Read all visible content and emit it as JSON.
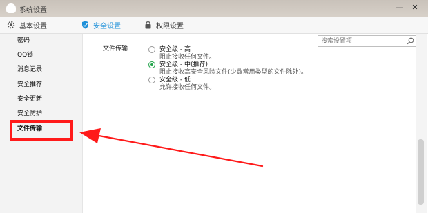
{
  "window": {
    "title": "系统设置"
  },
  "tabs": [
    {
      "label": "基本设置",
      "icon": "gear-icon"
    },
    {
      "label": "安全设置",
      "icon": "shield-icon",
      "active": true
    },
    {
      "label": "权限设置",
      "icon": "lock-icon"
    }
  ],
  "search": {
    "placeholder": "搜索设置项"
  },
  "sidebar": {
    "items": [
      {
        "label": "密码"
      },
      {
        "label": "QQ锁"
      },
      {
        "label": "消息记录"
      },
      {
        "label": "安全推荐"
      },
      {
        "label": "安全更新"
      },
      {
        "label": "安全防护"
      },
      {
        "label": "文件传输",
        "selected": true
      }
    ]
  },
  "main": {
    "section_label": "文件传输",
    "options": [
      {
        "title": "安全级 - 高",
        "desc": "阻止接收任何文件。",
        "checked": false
      },
      {
        "title": "安全级 - 中(推荐)",
        "desc": "阻止接收高安全风险文件(少数常用类型的文件除外)。",
        "checked": true
      },
      {
        "title": "安全级 - 低",
        "desc": "允许接收任何文件。",
        "checked": false
      }
    ]
  },
  "colors": {
    "accent": "#1e90d9",
    "highlight": "#ff1a1a",
    "radio_selected": "#21a34a"
  }
}
